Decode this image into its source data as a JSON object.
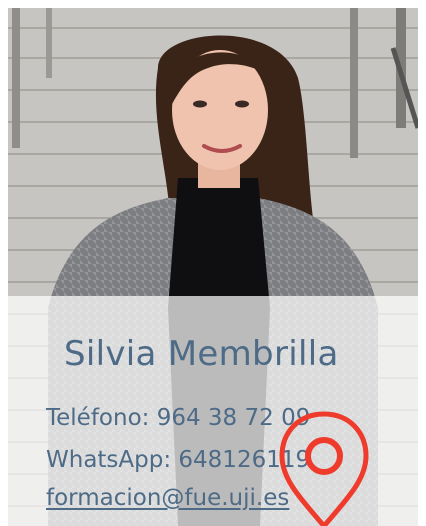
{
  "profile": {
    "name": "Silvia Membrilla",
    "phone_text": "Teléfono: 964 38 72 09",
    "whatsapp_text": "WhatsApp: 648126119",
    "email_text": "formacion@fue.uji.es"
  },
  "colors": {
    "text": "#4d6b86",
    "marker": "#ee3b2c",
    "overlay": "#ffffff"
  },
  "icons": {
    "marker": "location-pin-icon"
  }
}
